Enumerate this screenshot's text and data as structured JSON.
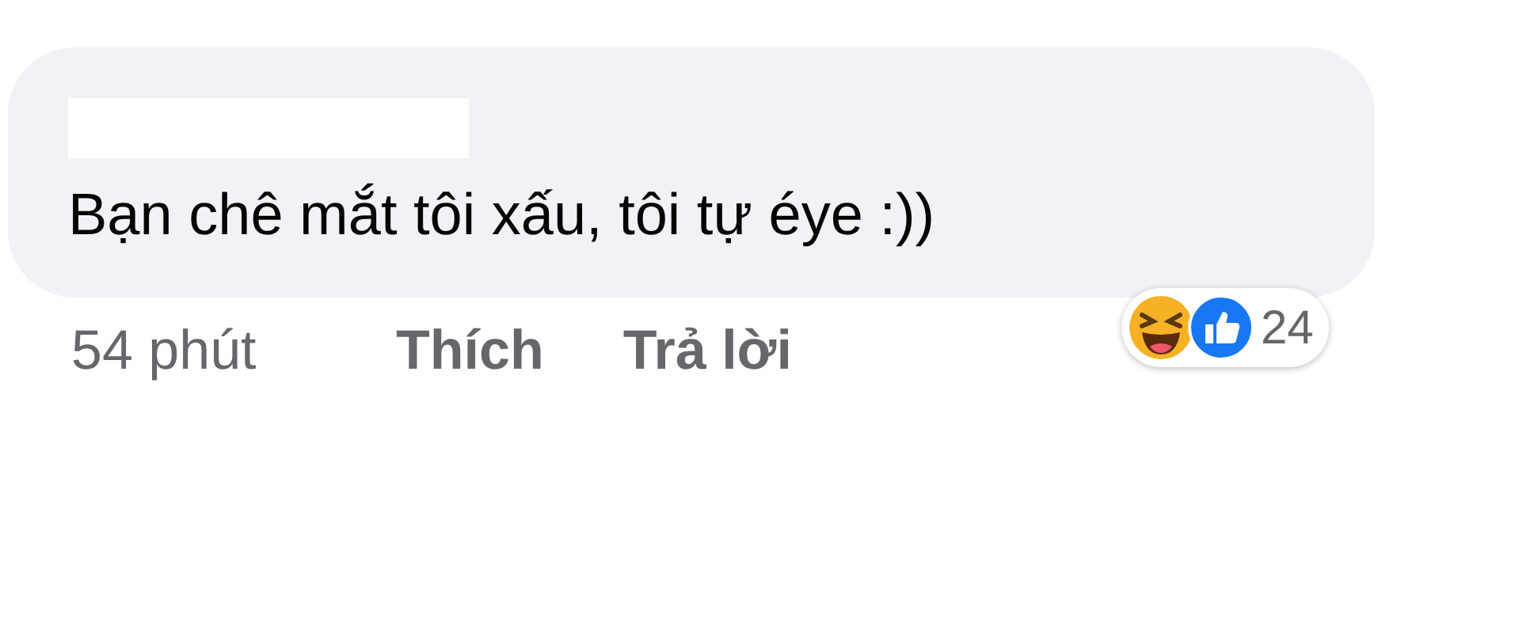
{
  "comment": {
    "text": "Bạn chê mắt tôi xấu, tôi tự éye :))",
    "time": "54 phút",
    "actions": [
      "Thích",
      "Trả lời"
    ],
    "reaction_count": "24"
  }
}
